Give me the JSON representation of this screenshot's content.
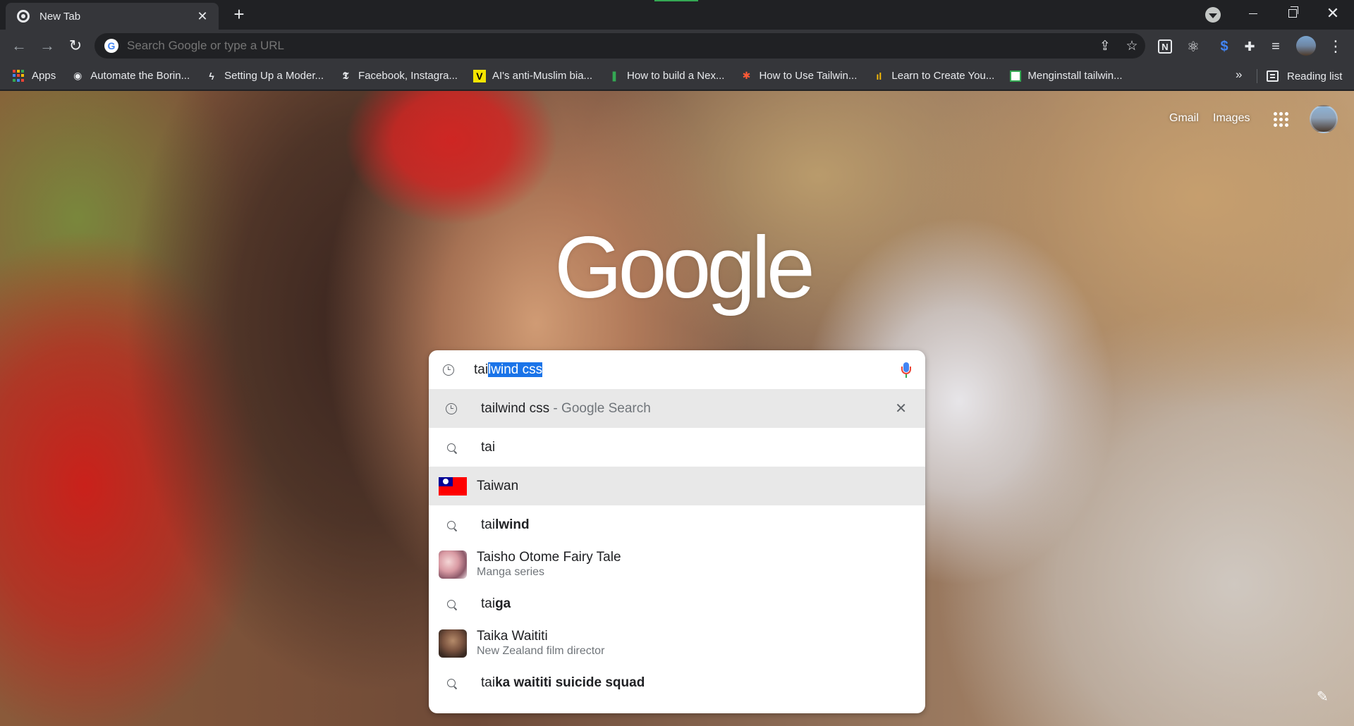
{
  "window": {
    "tab_title": "New Tab",
    "tab_close": "✕",
    "new_tab": "+",
    "min": "",
    "close": "✕"
  },
  "toolbar": {
    "back": "←",
    "forward": "→",
    "reload": "↻",
    "omnibox_placeholder": "Search Google or type a URL",
    "g_letter": "G",
    "share": "⇪",
    "star": "☆",
    "notion_letter": "N",
    "react": "⚛",
    "dollar": "$",
    "puzzle": "✚",
    "media": "≡",
    "menu": "⋮"
  },
  "bookmarks": {
    "items": [
      {
        "label": "Apps",
        "icon": "apps-grid-icon"
      },
      {
        "label": "Automate the Borin...",
        "icon": "globe-icon"
      },
      {
        "label": "Setting Up a Moder...",
        "icon": "bolt-icon"
      },
      {
        "label": "Facebook, Instagra...",
        "icon": "nyt-icon"
      },
      {
        "label": "AI's anti-Muslim bia...",
        "icon": "vice-icon"
      },
      {
        "label": "How to build a Nex...",
        "icon": "leaf-icon"
      },
      {
        "label": "How to Use Tailwin...",
        "icon": "asterisk-icon"
      },
      {
        "label": "Learn to Create You...",
        "icon": "chart-icon"
      },
      {
        "label": "Menginstall tailwin...",
        "icon": "page-icon"
      }
    ],
    "icon_glyphs": {
      "globe": "◉",
      "bolt": "ϟ",
      "nyt": "𝕿",
      "vice": "V",
      "leaf": "❚",
      "asterisk": "✱",
      "chart": "ıl"
    },
    "more": "»",
    "reading_list": "Reading list"
  },
  "ntp": {
    "gmail": "Gmail",
    "images": "Images",
    "logo": "Google",
    "edit": "✎"
  },
  "search": {
    "typed": "tai",
    "autocomplete": "lwind css",
    "suggestions": [
      {
        "type": "history",
        "bold": "tailwind css",
        "sep": " - ",
        "dim": "Google Search",
        "remove": "✕"
      },
      {
        "type": "search",
        "pre": "tai",
        "bold": ""
      },
      {
        "type": "entity-flag",
        "pre": "Tai",
        "bold": "wan"
      },
      {
        "type": "search",
        "pre": "tai",
        "bold": "lwind"
      },
      {
        "type": "entity",
        "pre": "Tai",
        "bold": "sho Otome Fairy Tale",
        "subtitle": "Manga series"
      },
      {
        "type": "search",
        "pre": "tai",
        "bold": "ga"
      },
      {
        "type": "entity",
        "pre": "Tai",
        "bold": "ka Waititi",
        "subtitle": "New Zealand film director"
      },
      {
        "type": "search",
        "pre": "tai",
        "bold": "ka waititi suicide squad"
      }
    ]
  },
  "colors": {
    "chrome_dark": "#202124",
    "chrome_toolbar": "#35363a",
    "selection": "#1a73e8",
    "google_blue": "#4285f4",
    "google_red": "#ea4335",
    "google_green": "#34a853",
    "google_yellow": "#fbbc05"
  }
}
